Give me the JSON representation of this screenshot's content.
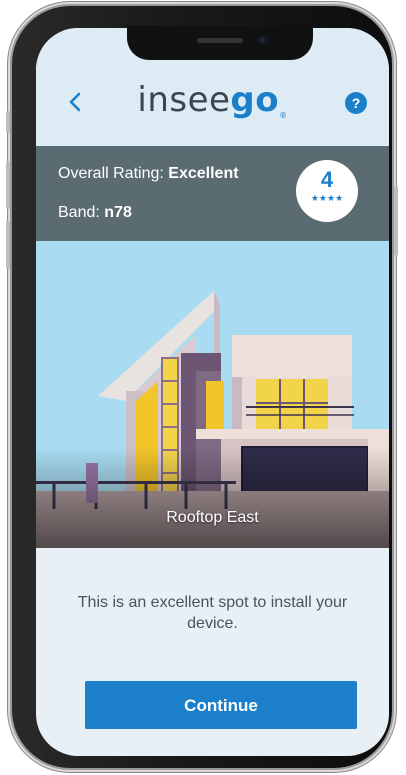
{
  "header": {
    "logo_main": "insee",
    "logo_accent": "go",
    "logo_mark": "®",
    "back_icon": "chevron-left-icon",
    "help_label": "?"
  },
  "rating": {
    "overall_label": "Overall Rating:",
    "overall_value": "Excellent",
    "band_label": "Band:",
    "band_value": "n78",
    "score": "4",
    "stars": "★★★★"
  },
  "scene": {
    "location": "Rooftop East"
  },
  "message": "This is an excellent spot to install your device.",
  "continue_label": "Continue",
  "colors": {
    "brand_blue": "#1b7fc9",
    "rating_bar": "#5b6b72",
    "header_bg": "#ddebf4"
  }
}
